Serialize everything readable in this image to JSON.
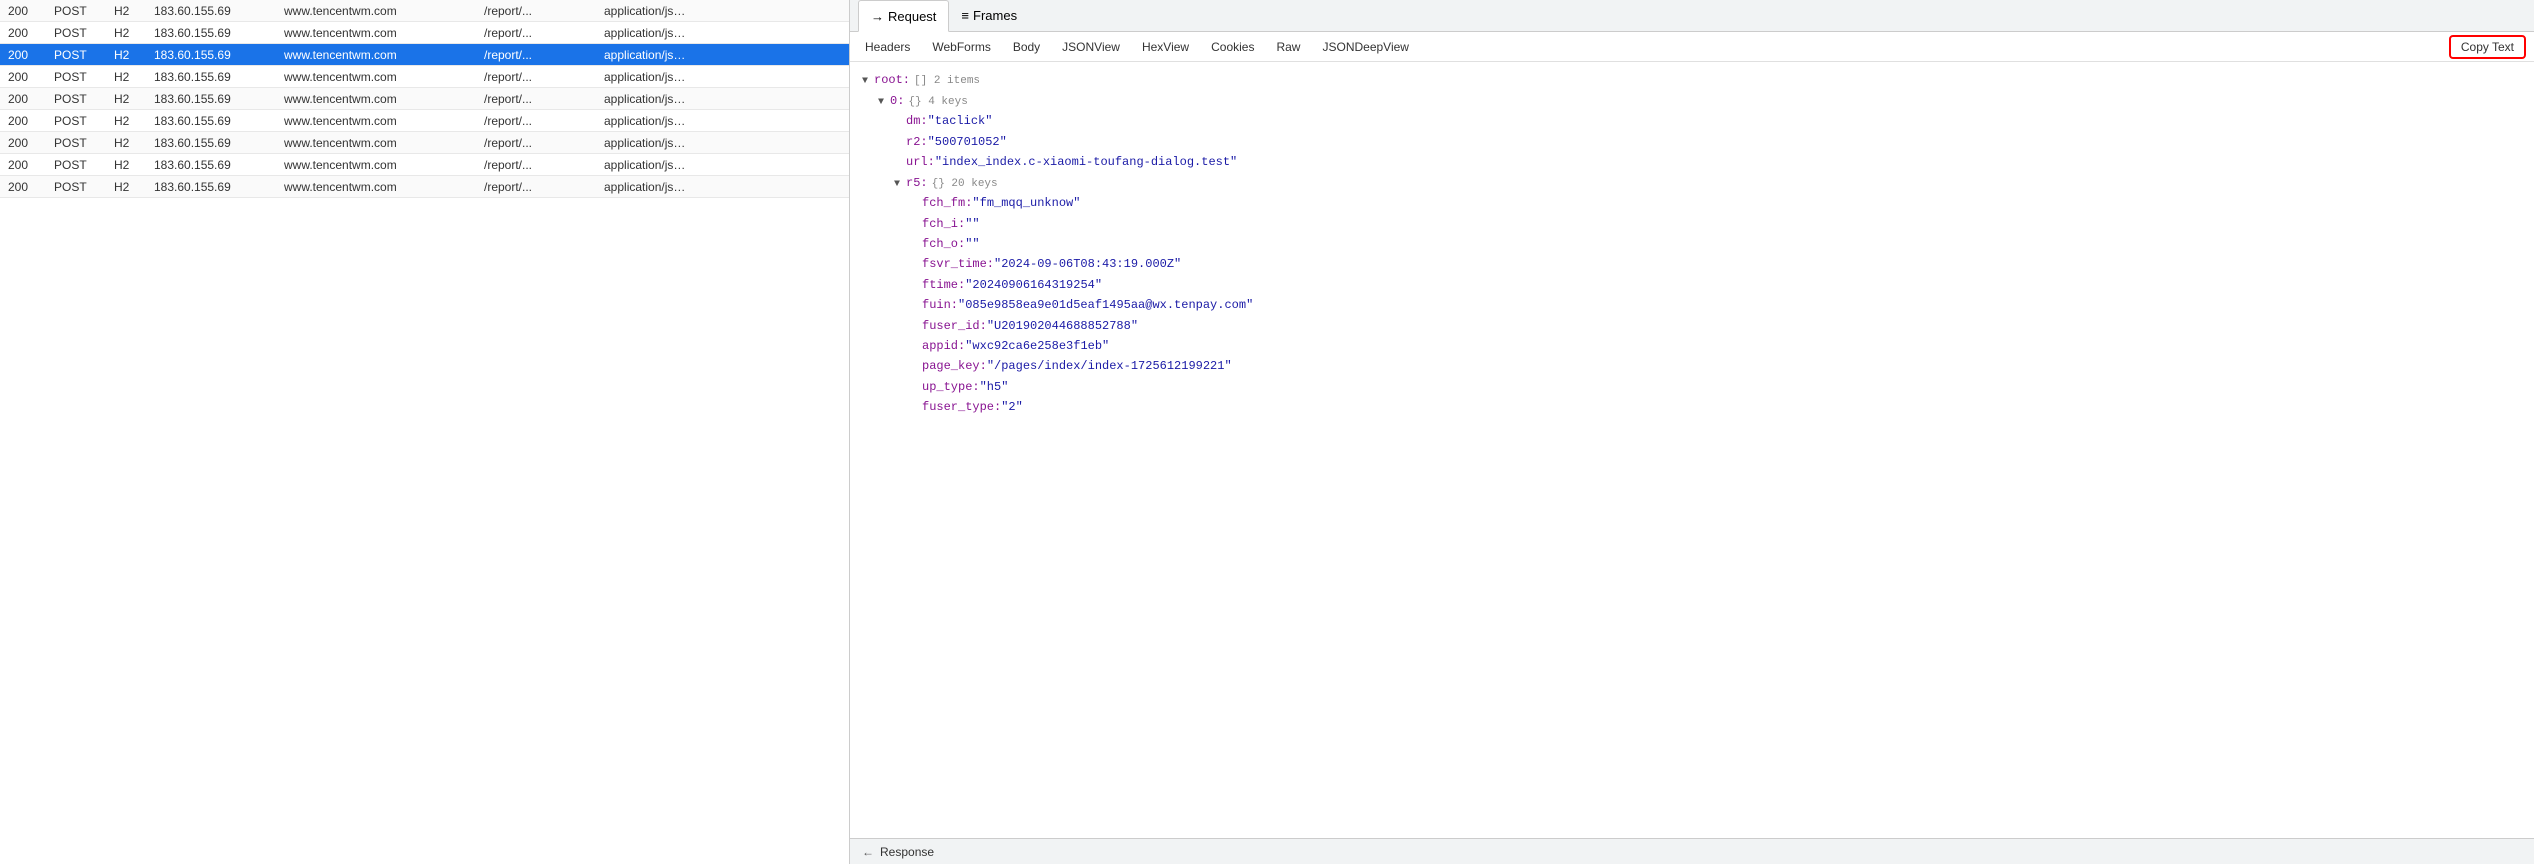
{
  "left_panel": {
    "rows": [
      {
        "status": "200",
        "method": "POST",
        "protocol": "H2",
        "ip": "183.60.155.69",
        "host": "www.tencentwm.com",
        "path": "/report/...",
        "type": "application/js…",
        "highlighted": false
      },
      {
        "status": "200",
        "method": "POST",
        "protocol": "H2",
        "ip": "183.60.155.69",
        "host": "www.tencentwm.com",
        "path": "/report/...",
        "type": "application/js…",
        "highlighted": false
      },
      {
        "status": "200",
        "method": "POST",
        "protocol": "H2",
        "ip": "183.60.155.69",
        "host": "www.tencentwm.com",
        "path": "/report/...",
        "type": "application/js…",
        "highlighted": true
      },
      {
        "status": "200",
        "method": "POST",
        "protocol": "H2",
        "ip": "183.60.155.69",
        "host": "www.tencentwm.com",
        "path": "/report/...",
        "type": "application/js…",
        "highlighted": false
      },
      {
        "status": "200",
        "method": "POST",
        "protocol": "H2",
        "ip": "183.60.155.69",
        "host": "www.tencentwm.com",
        "path": "/report/...",
        "type": "application/js…",
        "highlighted": false
      },
      {
        "status": "200",
        "method": "POST",
        "protocol": "H2",
        "ip": "183.60.155.69",
        "host": "www.tencentwm.com",
        "path": "/report/...",
        "type": "application/js…",
        "highlighted": false
      },
      {
        "status": "200",
        "method": "POST",
        "protocol": "H2",
        "ip": "183.60.155.69",
        "host": "www.tencentwm.com",
        "path": "/report/...",
        "type": "application/js…",
        "highlighted": false
      },
      {
        "status": "200",
        "method": "POST",
        "protocol": "H2",
        "ip": "183.60.155.69",
        "host": "www.tencentwm.com",
        "path": "/report/...",
        "type": "application/js…",
        "highlighted": false
      },
      {
        "status": "200",
        "method": "POST",
        "protocol": "H2",
        "ip": "183.60.155.69",
        "host": "www.tencentwm.com",
        "path": "/report/...",
        "type": "application/js…",
        "highlighted": false
      }
    ]
  },
  "right_panel": {
    "top_tabs": [
      {
        "label": "Request",
        "icon": "→",
        "active": true
      },
      {
        "label": "Frames",
        "icon": "≡",
        "active": false
      }
    ],
    "sub_tabs": [
      {
        "label": "Headers"
      },
      {
        "label": "WebForms"
      },
      {
        "label": "Body"
      },
      {
        "label": "JSONView"
      },
      {
        "label": "HexView"
      },
      {
        "label": "Cookies"
      },
      {
        "label": "Raw"
      },
      {
        "label": "JSONDeepView"
      }
    ],
    "copy_text_label": "Copy Text",
    "json_tree": {
      "root_label": "root:",
      "root_type": "[]",
      "root_count": "2 items",
      "item0_label": "0:",
      "item0_type": "{}",
      "item0_count": "4 keys",
      "dm_key": "dm:",
      "dm_value": "\"taclick\"",
      "r2_key": "r2:",
      "r2_value": "\"500701052\"",
      "url_key": "url:",
      "url_value": "\"index_index.c-xiaomi-toufang-dialog.test\"",
      "r5_key": "r5:",
      "r5_type": "{}",
      "r5_count": "20 keys",
      "fch_fm_key": "fch_fm:",
      "fch_fm_value": "\"fm_mqq_unknow\"",
      "fch_i_key": "fch_i:",
      "fch_i_value": "\"\"",
      "fch_o_key": "fch_o:",
      "fch_o_value": "\"\"",
      "fsvr_time_key": "fsvr_time:",
      "fsvr_time_value": "\"2024-09-06T08:43:19.000Z\"",
      "ftime_key": "ftime:",
      "ftime_value": "\"20240906164319254\"",
      "fuin_key": "fuin:",
      "fuin_value": "\"085e9858ea9e01d5eaf1495aa@wx.tenpay.com\"",
      "fuser_id_key": "fuser_id:",
      "fuser_id_value": "\"U201902044688852788\"",
      "appid_key": "appid:",
      "appid_value": "\"wxc92ca6e258e3f1eb\"",
      "page_key_key": "page_key:",
      "page_key_value": "\"/pages/index/index-1725612199221\"",
      "up_type_key": "up_type:",
      "up_type_value": "\"h5\"",
      "fuser_type_key": "fuser_type:",
      "fuser_type_value": "\"2\""
    },
    "bottom_bar": {
      "icon": "←",
      "label": "Response"
    }
  }
}
